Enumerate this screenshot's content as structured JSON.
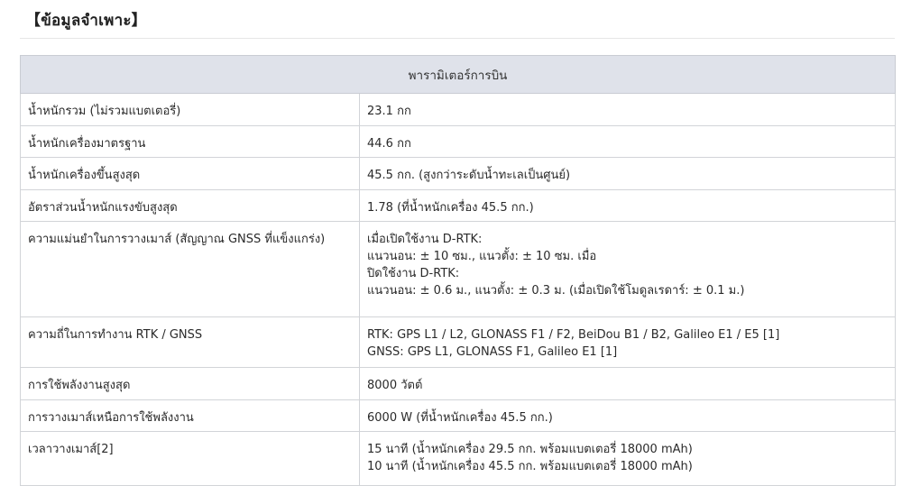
{
  "section_title": "【ข้อมูลจำเพาะ】",
  "table": {
    "header": "พารามิเตอร์การบิน",
    "rows": [
      {
        "label": "น้ำหนักรวม (ไม่รวมแบตเตอรี่)",
        "value": [
          "23.1 กก"
        ]
      },
      {
        "label": "น้ำหนักเครื่องมาตรฐาน",
        "value": [
          "44.6 กก"
        ]
      },
      {
        "label": "น้ำหนักเครื่องขึ้นสูงสุด",
        "value": [
          "45.5 กก. (สูงกว่าระดับน้ำทะเลเป็นศูนย์)"
        ]
      },
      {
        "label": "อัตราส่วนน้ำหนักแรงขับสูงสุด",
        "value": [
          "1.78 (ที่น้ำหนักเครื่อง 45.5 กก.)"
        ]
      },
      {
        "label": "ความแม่นยำในการวางเมาส์ (สัญญาณ GNSS ที่แข็งแกร่ง)",
        "value": [
          "เมื่อเปิดใช้งาน D-RTK:",
          "แนวนอน: ± 10 ซม., แนวตั้ง: ± 10 ซม. เมื่อ",
          "ปิดใช้งาน D-RTK:",
          "แนวนอน: ± 0.6 ม., แนวตั้ง: ± 0.3 ม. (เมื่อเปิดใช้โมดูลเรดาร์: ± 0.1 ม.)"
        ]
      },
      {
        "label": "ความถี่ในการทำงาน RTK / GNSS",
        "value": [
          "RTK: GPS L1 / L2, GLONASS F1 / F2, BeiDou B1 / B2, Galileo E1 / E5 [1]",
          "GNSS: GPS L1, GLONASS F1, Galileo E1 [1]"
        ]
      },
      {
        "label": "การใช้พลังงานสูงสุด",
        "value": [
          "8000 วัตต์"
        ]
      },
      {
        "label": "การวางเมาส์เหนือการใช้พลังงาน",
        "value": [
          "6000 W (ที่น้ำหนักเครื่อง 45.5 กก.)"
        ]
      },
      {
        "label": "เวลาวางเมาส์[2]",
        "value": [
          "15 นาที (น้ำหนักเครื่อง 29.5 กก. พร้อมแบตเตอรี่ 18000 mAh)",
          "10 นาที (น้ำหนักเครื่อง 45.5 กก. พร้อมแบตเตอรี่ 18000 mAh)"
        ]
      }
    ]
  }
}
